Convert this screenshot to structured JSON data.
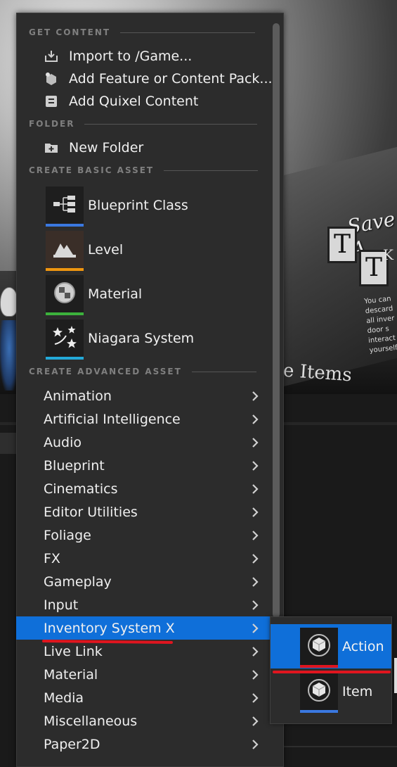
{
  "background": {
    "wall_title": "Save A",
    "wall_items": "e Items",
    "wall_t1": "T",
    "wall_t2": "T",
    "wall_k": "K",
    "wall_text": "You can descard all inver door s interact yourself"
  },
  "menu": {
    "sections": {
      "get_content": "GET CONTENT",
      "folder": "FOLDER",
      "create_basic_asset": "CREATE BASIC ASSET",
      "create_advanced_asset": "CREATE ADVANCED ASSET"
    },
    "get_content_items": [
      {
        "label": "Import to /Game...",
        "icon": "import-icon"
      },
      {
        "label": "Add Feature or Content Pack...",
        "icon": "feature-pack-icon"
      },
      {
        "label": "Add Quixel Content",
        "icon": "quixel-icon"
      }
    ],
    "folder_items": [
      {
        "label": "New Folder",
        "icon": "new-folder-icon"
      }
    ],
    "basic_assets": [
      {
        "label": "Blueprint Class",
        "icon": "blueprint-class-icon",
        "color": "#3a78e0"
      },
      {
        "label": "Level",
        "icon": "level-icon",
        "color": "#f0960f"
      },
      {
        "label": "Material",
        "icon": "material-icon",
        "color": "#3cb23c"
      },
      {
        "label": "Niagara System",
        "icon": "niagara-icon",
        "color": "#23a9d8"
      }
    ],
    "advanced_assets": [
      "Animation",
      "Artificial Intelligence",
      "Audio",
      "Blueprint",
      "Cinematics",
      "Editor Utilities",
      "Foliage",
      "FX",
      "Gameplay",
      "Input",
      "Inventory System X",
      "Live Link",
      "Material",
      "Media",
      "Miscellaneous",
      "Paper2D"
    ],
    "selected_advanced": "Inventory System X"
  },
  "submenu": {
    "items": [
      {
        "label": "Action",
        "icon": "cube-icon",
        "color": "#e0151f"
      },
      {
        "label": "Item",
        "icon": "cube-icon",
        "color": "#3a78e0"
      }
    ],
    "selected": "Action"
  },
  "colors": {
    "menu_bg": "#2c2c2c",
    "selection": "#0f6fd9",
    "annotation_red": "#e0151f"
  }
}
